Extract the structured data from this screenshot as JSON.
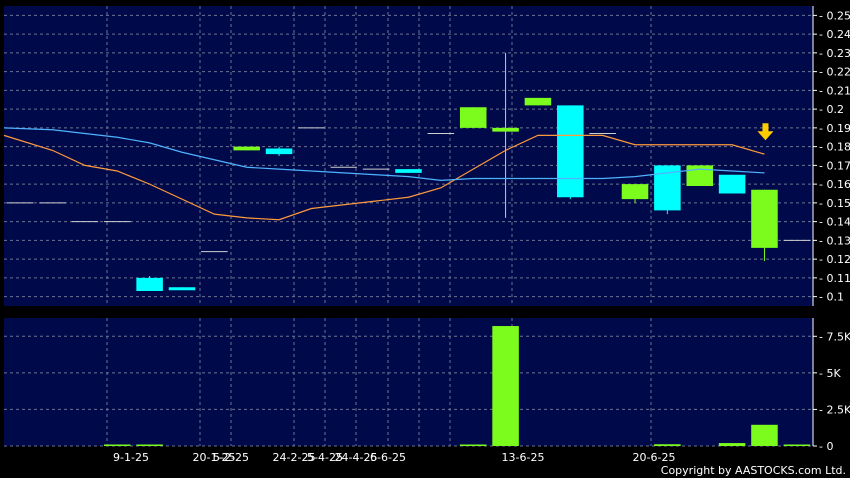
{
  "copyright": "Copyright by AASTOCKS.com Ltd.",
  "colors": {
    "background": "#000000",
    "plot_bg": "#000a4a",
    "grid": "#6d7390",
    "up": "#7cfc1c",
    "down": "#00ffff",
    "ma_short": "#ff9a3c",
    "ma_long": "#4fb3ff",
    "arrow": "#ffcc00",
    "flat": "#d0d0d0"
  },
  "chart_data": [
    {
      "type": "candlestick",
      "title": "",
      "ylim": [
        0.095,
        0.255
      ],
      "y_ticks": [
        0.1,
        0.11,
        0.12,
        0.13,
        0.14,
        0.15,
        0.16,
        0.17,
        0.18,
        0.19,
        0.2,
        0.21,
        0.22,
        0.23,
        0.24,
        0.25
      ],
      "y_tick_labels": [
        "0.1",
        "0.11",
        "0.12",
        "0.13",
        "0.14",
        "0.15",
        "0.16",
        "0.17",
        "0.18",
        "0.19",
        "0.2",
        "0.21",
        "0.22",
        "0.23",
        "0.24",
        "0.25"
      ],
      "x_labels": [
        "9-1-25",
        "20-1-25",
        "5-2-25",
        "24-2-25",
        "5-4-25",
        "24-4-25",
        "6-6-25",
        "13-6-25",
        "20-6-25"
      ],
      "candles": [
        {
          "o": 0.15,
          "h": 0.15,
          "l": 0.15,
          "c": 0.15
        },
        {
          "o": 0.15,
          "h": 0.15,
          "l": 0.15,
          "c": 0.15
        },
        {
          "o": 0.14,
          "h": 0.14,
          "l": 0.14,
          "c": 0.14
        },
        {
          "o": 0.14,
          "h": 0.14,
          "l": 0.14,
          "c": 0.14
        },
        {
          "o": 0.11,
          "h": 0.111,
          "l": 0.103,
          "c": 0.103
        },
        {
          "o": 0.105,
          "h": 0.105,
          "l": 0.104,
          "c": 0.104
        },
        {
          "o": 0.124,
          "h": 0.124,
          "l": 0.124,
          "c": 0.124
        },
        {
          "o": 0.178,
          "h": 0.18,
          "l": 0.178,
          "c": 0.18
        },
        {
          "o": 0.179,
          "h": 0.18,
          "l": 0.175,
          "c": 0.176
        },
        {
          "o": 0.19,
          "h": 0.19,
          "l": 0.19,
          "c": 0.19
        },
        {
          "o": 0.169,
          "h": 0.169,
          "l": 0.169,
          "c": 0.169
        },
        {
          "o": 0.168,
          "h": 0.168,
          "l": 0.168,
          "c": 0.168
        },
        {
          "o": 0.168,
          "h": 0.168,
          "l": 0.166,
          "c": 0.166
        },
        {
          "o": 0.187,
          "h": 0.187,
          "l": 0.187,
          "c": 0.187
        },
        {
          "o": 0.19,
          "h": 0.201,
          "l": 0.19,
          "c": 0.201
        },
        {
          "o": 0.188,
          "h": 0.23,
          "l": 0.142,
          "c": 0.19
        },
        {
          "o": 0.202,
          "h": 0.206,
          "l": 0.202,
          "c": 0.206
        },
        {
          "o": 0.202,
          "h": 0.202,
          "l": 0.152,
          "c": 0.153
        },
        {
          "o": 0.187,
          "h": 0.187,
          "l": 0.187,
          "c": 0.187
        },
        {
          "o": 0.152,
          "h": 0.16,
          "l": 0.15,
          "c": 0.16
        },
        {
          "o": 0.17,
          "h": 0.17,
          "l": 0.144,
          "c": 0.146
        },
        {
          "o": 0.159,
          "h": 0.17,
          "l": 0.159,
          "c": 0.17
        },
        {
          "o": 0.165,
          "h": 0.165,
          "l": 0.155,
          "c": 0.155
        },
        {
          "o": 0.126,
          "h": 0.157,
          "l": 0.119,
          "c": 0.157
        },
        {
          "o": 0.13,
          "h": 0.13,
          "l": 0.13,
          "c": 0.13
        }
      ],
      "ma_short": [
        0.186,
        0.178,
        0.17,
        0.167,
        0.16,
        0.152,
        0.144,
        0.142,
        0.141,
        0.147,
        0.149,
        0.151,
        0.153,
        0.158,
        0.168,
        0.178,
        0.186,
        0.186,
        0.186,
        0.181,
        0.181,
        0.181,
        0.181,
        0.176
      ],
      "ma_long": [
        0.19,
        0.189,
        0.187,
        0.185,
        0.182,
        0.177,
        0.173,
        0.169,
        0.168,
        0.167,
        0.166,
        0.165,
        0.164,
        0.162,
        0.163,
        0.163,
        0.163,
        0.163,
        0.163,
        0.164,
        0.166,
        0.168,
        0.167,
        0.166
      ],
      "arrow_value": 0.185
    },
    {
      "type": "bar",
      "title": "",
      "ylim": [
        0,
        8750
      ],
      "y_ticks": [
        0,
        2500,
        5000,
        7500
      ],
      "y_tick_labels": [
        "0",
        "2.5K",
        "5K",
        "7.5K"
      ],
      "values": [
        0,
        0,
        0,
        40,
        70,
        0,
        0,
        0,
        0,
        0,
        0,
        0,
        0,
        0,
        40,
        8200,
        0,
        0,
        0,
        0,
        120,
        0,
        200,
        1450,
        60
      ]
    }
  ]
}
